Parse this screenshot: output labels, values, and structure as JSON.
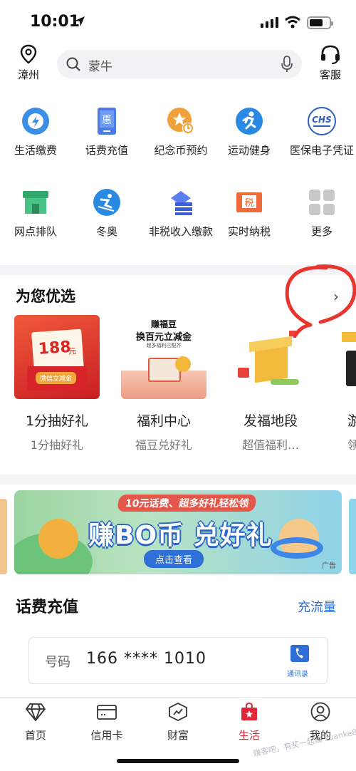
{
  "status": {
    "time": "10:01"
  },
  "header": {
    "location": "漳州",
    "search_placeholder": "蒙牛",
    "service": "客服"
  },
  "grid": {
    "items": [
      {
        "label": "生活缴费",
        "icon": "lightning-icon"
      },
      {
        "label": "话费充值",
        "icon": "phone-card-icon"
      },
      {
        "label": "纪念币预约",
        "icon": "coin-star-icon"
      },
      {
        "label": "运动健身",
        "icon": "runner-icon"
      },
      {
        "label": "医保电子凭证",
        "icon": "chs-icon"
      },
      {
        "label": "网点排队",
        "icon": "store-icon"
      },
      {
        "label": "冬奥",
        "icon": "skier-icon"
      },
      {
        "label": "非税收入缴款",
        "icon": "stack-icon"
      },
      {
        "label": "实时纳税",
        "icon": "tax-icon"
      },
      {
        "label": "更多",
        "icon": "more-grid-icon"
      }
    ]
  },
  "recommend": {
    "title": "为您优选",
    "cards": [
      {
        "name": "1分抽好礼",
        "sub": "1分抽好礼",
        "img_amount": "188",
        "img_unit": "元",
        "img_tag": "微信立减金"
      },
      {
        "name": "福利中心",
        "sub": "福豆兑好礼",
        "img_line1": "赚福豆",
        "img_line2": "换百元立减金",
        "img_line3": "超多福利已配齐"
      },
      {
        "name": "发福地段",
        "sub": "超值福利…"
      },
      {
        "name": "游",
        "sub": "领"
      }
    ]
  },
  "banner": {
    "top_text": "10元话费、超多好礼轻松领",
    "headline": "赚BO币 兑好礼",
    "button": "点击查看",
    "ad": "广告"
  },
  "topup": {
    "title": "话费充值",
    "flow_link": "充流量",
    "number_label": "号码",
    "number": "166 **** 1010",
    "contacts": "通讯录"
  },
  "tabs": [
    {
      "label": "首页",
      "icon": "diamond-icon",
      "active": false
    },
    {
      "label": "信用卡",
      "icon": "credit-card-icon",
      "active": false
    },
    {
      "label": "财富",
      "icon": "wealth-chart-icon",
      "active": false
    },
    {
      "label": "生活",
      "icon": "shopping-bag-icon",
      "active": true
    },
    {
      "label": "我的",
      "icon": "user-icon",
      "active": false
    }
  ],
  "watermark": "赚客吧，有奖一起赚 zuanke8",
  "colors": {
    "accent_red": "#e2263a",
    "link_blue": "#2d6fd6"
  }
}
